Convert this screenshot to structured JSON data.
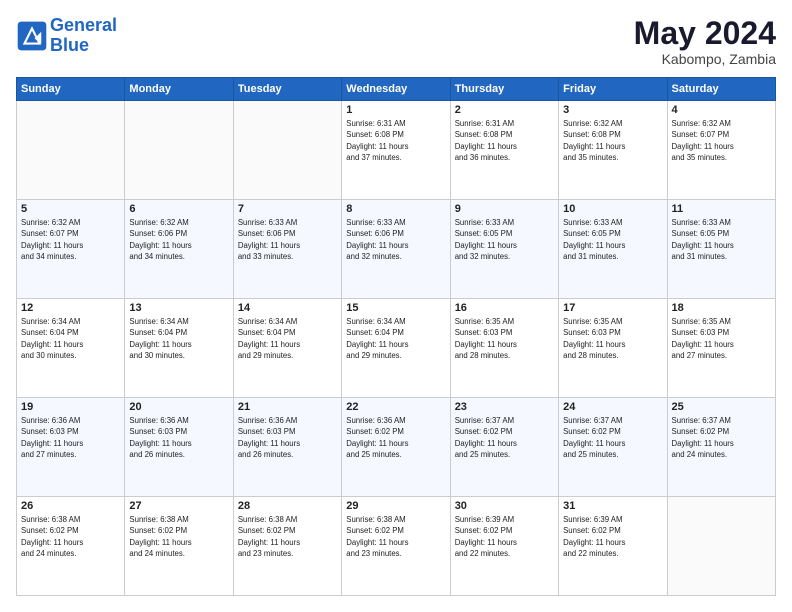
{
  "logo": {
    "line1": "General",
    "line2": "Blue"
  },
  "header": {
    "month": "May 2024",
    "location": "Kabompo, Zambia"
  },
  "days_of_week": [
    "Sunday",
    "Monday",
    "Tuesday",
    "Wednesday",
    "Thursday",
    "Friday",
    "Saturday"
  ],
  "weeks": [
    [
      {
        "day": "",
        "content": ""
      },
      {
        "day": "",
        "content": ""
      },
      {
        "day": "",
        "content": ""
      },
      {
        "day": "1",
        "content": "Sunrise: 6:31 AM\nSunset: 6:08 PM\nDaylight: 11 hours\nand 37 minutes."
      },
      {
        "day": "2",
        "content": "Sunrise: 6:31 AM\nSunset: 6:08 PM\nDaylight: 11 hours\nand 36 minutes."
      },
      {
        "day": "3",
        "content": "Sunrise: 6:32 AM\nSunset: 6:08 PM\nDaylight: 11 hours\nand 35 minutes."
      },
      {
        "day": "4",
        "content": "Sunrise: 6:32 AM\nSunset: 6:07 PM\nDaylight: 11 hours\nand 35 minutes."
      }
    ],
    [
      {
        "day": "5",
        "content": "Sunrise: 6:32 AM\nSunset: 6:07 PM\nDaylight: 11 hours\nand 34 minutes."
      },
      {
        "day": "6",
        "content": "Sunrise: 6:32 AM\nSunset: 6:06 PM\nDaylight: 11 hours\nand 34 minutes."
      },
      {
        "day": "7",
        "content": "Sunrise: 6:33 AM\nSunset: 6:06 PM\nDaylight: 11 hours\nand 33 minutes."
      },
      {
        "day": "8",
        "content": "Sunrise: 6:33 AM\nSunset: 6:06 PM\nDaylight: 11 hours\nand 32 minutes."
      },
      {
        "day": "9",
        "content": "Sunrise: 6:33 AM\nSunset: 6:05 PM\nDaylight: 11 hours\nand 32 minutes."
      },
      {
        "day": "10",
        "content": "Sunrise: 6:33 AM\nSunset: 6:05 PM\nDaylight: 11 hours\nand 31 minutes."
      },
      {
        "day": "11",
        "content": "Sunrise: 6:33 AM\nSunset: 6:05 PM\nDaylight: 11 hours\nand 31 minutes."
      }
    ],
    [
      {
        "day": "12",
        "content": "Sunrise: 6:34 AM\nSunset: 6:04 PM\nDaylight: 11 hours\nand 30 minutes."
      },
      {
        "day": "13",
        "content": "Sunrise: 6:34 AM\nSunset: 6:04 PM\nDaylight: 11 hours\nand 30 minutes."
      },
      {
        "day": "14",
        "content": "Sunrise: 6:34 AM\nSunset: 6:04 PM\nDaylight: 11 hours\nand 29 minutes."
      },
      {
        "day": "15",
        "content": "Sunrise: 6:34 AM\nSunset: 6:04 PM\nDaylight: 11 hours\nand 29 minutes."
      },
      {
        "day": "16",
        "content": "Sunrise: 6:35 AM\nSunset: 6:03 PM\nDaylight: 11 hours\nand 28 minutes."
      },
      {
        "day": "17",
        "content": "Sunrise: 6:35 AM\nSunset: 6:03 PM\nDaylight: 11 hours\nand 28 minutes."
      },
      {
        "day": "18",
        "content": "Sunrise: 6:35 AM\nSunset: 6:03 PM\nDaylight: 11 hours\nand 27 minutes."
      }
    ],
    [
      {
        "day": "19",
        "content": "Sunrise: 6:36 AM\nSunset: 6:03 PM\nDaylight: 11 hours\nand 27 minutes."
      },
      {
        "day": "20",
        "content": "Sunrise: 6:36 AM\nSunset: 6:03 PM\nDaylight: 11 hours\nand 26 minutes."
      },
      {
        "day": "21",
        "content": "Sunrise: 6:36 AM\nSunset: 6:03 PM\nDaylight: 11 hours\nand 26 minutes."
      },
      {
        "day": "22",
        "content": "Sunrise: 6:36 AM\nSunset: 6:02 PM\nDaylight: 11 hours\nand 25 minutes."
      },
      {
        "day": "23",
        "content": "Sunrise: 6:37 AM\nSunset: 6:02 PM\nDaylight: 11 hours\nand 25 minutes."
      },
      {
        "day": "24",
        "content": "Sunrise: 6:37 AM\nSunset: 6:02 PM\nDaylight: 11 hours\nand 25 minutes."
      },
      {
        "day": "25",
        "content": "Sunrise: 6:37 AM\nSunset: 6:02 PM\nDaylight: 11 hours\nand 24 minutes."
      }
    ],
    [
      {
        "day": "26",
        "content": "Sunrise: 6:38 AM\nSunset: 6:02 PM\nDaylight: 11 hours\nand 24 minutes."
      },
      {
        "day": "27",
        "content": "Sunrise: 6:38 AM\nSunset: 6:02 PM\nDaylight: 11 hours\nand 24 minutes."
      },
      {
        "day": "28",
        "content": "Sunrise: 6:38 AM\nSunset: 6:02 PM\nDaylight: 11 hours\nand 23 minutes."
      },
      {
        "day": "29",
        "content": "Sunrise: 6:38 AM\nSunset: 6:02 PM\nDaylight: 11 hours\nand 23 minutes."
      },
      {
        "day": "30",
        "content": "Sunrise: 6:39 AM\nSunset: 6:02 PM\nDaylight: 11 hours\nand 22 minutes."
      },
      {
        "day": "31",
        "content": "Sunrise: 6:39 AM\nSunset: 6:02 PM\nDaylight: 11 hours\nand 22 minutes."
      },
      {
        "day": "",
        "content": ""
      }
    ]
  ]
}
